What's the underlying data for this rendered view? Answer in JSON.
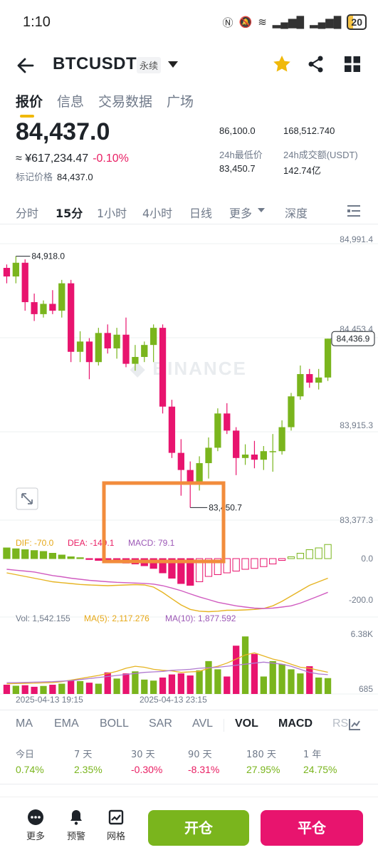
{
  "status_bar": {
    "time": "1:10",
    "battery": "20"
  },
  "header": {
    "symbol": "BTCUSDT",
    "badge": "永续"
  },
  "tabs": [
    "报价",
    "信息",
    "交易数据",
    "广场"
  ],
  "price": {
    "last": "84,437.0",
    "cny": "≈ ¥617,234.47",
    "change": "-0.10%",
    "mark_label": "标记价格",
    "mark_value": "84,437.0"
  },
  "stats": {
    "high_value": "86,100.0",
    "volume_btc": "168,512.740",
    "low_label": "24h最低价",
    "low_value": "83,450.7",
    "turnover_label": "24h成交额(USDT)",
    "turnover_value": "142.74亿"
  },
  "intervals": [
    "分时",
    "15分",
    "1小时",
    "4小时",
    "日线",
    "更多",
    "深度"
  ],
  "active_interval": "15分",
  "chart_data": {
    "type": "candlestick",
    "price_axis": [
      "84,991.4",
      "84,453.4",
      "83,915.3",
      "83,377.3"
    ],
    "ylim": [
      83377.3,
      84991.4
    ],
    "current_price_tag": "84,436.9",
    "high_marker": "84,918.0",
    "low_marker": "83,450.7",
    "watermark": "BINANCE",
    "candles": [
      [
        84850,
        84870,
        84760,
        84800
      ],
      [
        84800,
        84918,
        84760,
        84880
      ],
      [
        84880,
        84900,
        84600,
        84650
      ],
      [
        84650,
        84700,
        84540,
        84580
      ],
      [
        84580,
        84660,
        84560,
        84640
      ],
      [
        84640,
        84720,
        84580,
        84600
      ],
      [
        84600,
        84780,
        84560,
        84760
      ],
      [
        84760,
        84780,
        84300,
        84360
      ],
      [
        84360,
        84480,
        84300,
        84420
      ],
      [
        84420,
        84440,
        84200,
        84300
      ],
      [
        84300,
        84500,
        84280,
        84470
      ],
      [
        84470,
        84520,
        84350,
        84380
      ],
      [
        84380,
        84500,
        84320,
        84460
      ],
      [
        84460,
        84560,
        84270,
        84290
      ],
      [
        84290,
        84400,
        84250,
        84330
      ],
      [
        84330,
        84420,
        84300,
        84400
      ],
      [
        84400,
        84520,
        84300,
        84500
      ],
      [
        84500,
        84520,
        84000,
        84040
      ],
      [
        84040,
        84080,
        83740,
        83770
      ],
      [
        83770,
        83850,
        83520,
        83670
      ],
      [
        83670,
        83720,
        83450.7,
        83600
      ],
      [
        83600,
        83750,
        83550,
        83710
      ],
      [
        83710,
        83860,
        83620,
        83800
      ],
      [
        83800,
        84030,
        83780,
        84000
      ],
      [
        84000,
        84060,
        83880,
        83900
      ],
      [
        83900,
        83920,
        83640,
        83740
      ],
      [
        83740,
        83820,
        83700,
        83760
      ],
      [
        83760,
        83840,
        83680,
        83730
      ],
      [
        83730,
        83810,
        83670,
        83780
      ],
      [
        83780,
        83880,
        83660,
        83780
      ],
      [
        83780,
        83960,
        83760,
        83920
      ],
      [
        83920,
        84120,
        83900,
        84100
      ],
      [
        84100,
        84280,
        84080,
        84230
      ],
      [
        84230,
        84260,
        84150,
        84180
      ],
      [
        84180,
        84260,
        84140,
        84210
      ],
      [
        84210,
        84436.9,
        84190,
        84436.9
      ]
    ],
    "macd": {
      "dif_label": "DIF: -70.0",
      "dea_label": "DEA: -149.1",
      "macd_label": "MACD: 79.1",
      "axis": [
        "0.0",
        "-200.0"
      ],
      "histogram": [
        60,
        55,
        50,
        45,
        40,
        30,
        20,
        10,
        5,
        -5,
        -10,
        -15,
        -20,
        -25,
        -30,
        -40,
        -55,
        -80,
        -110,
        -140,
        -150,
        -130,
        -100,
        -90,
        -80,
        -70,
        -60,
        -55,
        -45,
        -30,
        -10,
        10,
        30,
        50,
        60,
        79.1
      ],
      "dif": [
        -40,
        -50,
        -60,
        -70,
        -80,
        -90,
        -95,
        -100,
        -105,
        -108,
        -110,
        -112,
        -110,
        -108,
        -106,
        -108,
        -120,
        -150,
        -185,
        -220,
        -245,
        -255,
        -258,
        -255,
        -250,
        -250,
        -248,
        -245,
        -240,
        -225,
        -200,
        -170,
        -140,
        -110,
        -90,
        -70
      ],
      "dea": [
        -20,
        -25,
        -30,
        -35,
        -45,
        -55,
        -62,
        -70,
        -76,
        -82,
        -86,
        -90,
        -93,
        -95,
        -97,
        -99,
        -103,
        -112,
        -125,
        -140,
        -158,
        -175,
        -190,
        -205,
        -215,
        -225,
        -232,
        -238,
        -240,
        -238,
        -232,
        -225,
        -210,
        -190,
        -170,
        -149.1
      ]
    },
    "volume": {
      "vol_label": "Vol: 1,542.155",
      "ma5_label": "MA(5): 2,117.276",
      "ma10_label": "MA(10): 1,877.592",
      "axis": [
        "6.38K",
        "685"
      ],
      "bars": [
        900,
        800,
        850,
        700,
        780,
        900,
        1000,
        1300,
        1250,
        1100,
        1000,
        2100,
        1500,
        2000,
        2200,
        1400,
        1300,
        1600,
        1900,
        2000,
        1800,
        2300,
        3200,
        2400,
        1700,
        4700,
        5600,
        3900,
        1700,
        3200,
        2900,
        2400,
        2000,
        2700,
        1600,
        1542.155
      ],
      "ma5": [
        1000,
        1020,
        1030,
        1050,
        1080,
        1100,
        1200,
        1350,
        1500,
        1650,
        1800,
        2000,
        2200,
        2500,
        2700,
        2600,
        2400,
        2300,
        2250,
        2100,
        2150,
        2200,
        2500,
        2700,
        3000,
        3400,
        3800,
        4000,
        3700,
        3400,
        3200,
        2900,
        2600,
        2500,
        2300,
        2117.276
      ],
      "ma10": [
        1100,
        1100,
        1120,
        1150,
        1180,
        1200,
        1250,
        1300,
        1400,
        1500,
        1600,
        1700,
        1800,
        1900,
        2000,
        2100,
        2150,
        2200,
        2300,
        2350,
        2400,
        2500,
        2550,
        2600,
        2700,
        2800,
        2900,
        3000,
        3100,
        3000,
        2900,
        2700,
        2400,
        2100,
        1950,
        1877.592
      ]
    },
    "time_labels": [
      "2025-04-13 19:15",
      "2025-04-13 23:15"
    ]
  },
  "indicator_tabs": [
    "MA",
    "EMA",
    "BOLL",
    "SAR",
    "AVL",
    "VOL",
    "MACD",
    "RS"
  ],
  "active_indicators": [
    "VOL",
    "MACD"
  ],
  "performance": [
    {
      "label": "今日",
      "value": "0.74%",
      "dir": "up"
    },
    {
      "label": "7 天",
      "value": "2.35%",
      "dir": "up"
    },
    {
      "label": "30 天",
      "value": "-0.30%",
      "dir": "down"
    },
    {
      "label": "90 天",
      "value": "-8.31%",
      "dir": "down"
    },
    {
      "label": "180 天",
      "value": "27.95%",
      "dir": "up"
    },
    {
      "label": "1 年",
      "value": "24.75%",
      "dir": "up"
    }
  ],
  "bottom_bar": {
    "more": "更多",
    "alert": "预警",
    "grid": "网格",
    "open": "开仓",
    "close": "平仓"
  },
  "colors": {
    "up": "#7ab51d",
    "down": "#e8146e",
    "accent": "#f0b90b",
    "highlight_box": "#f28c3c"
  }
}
